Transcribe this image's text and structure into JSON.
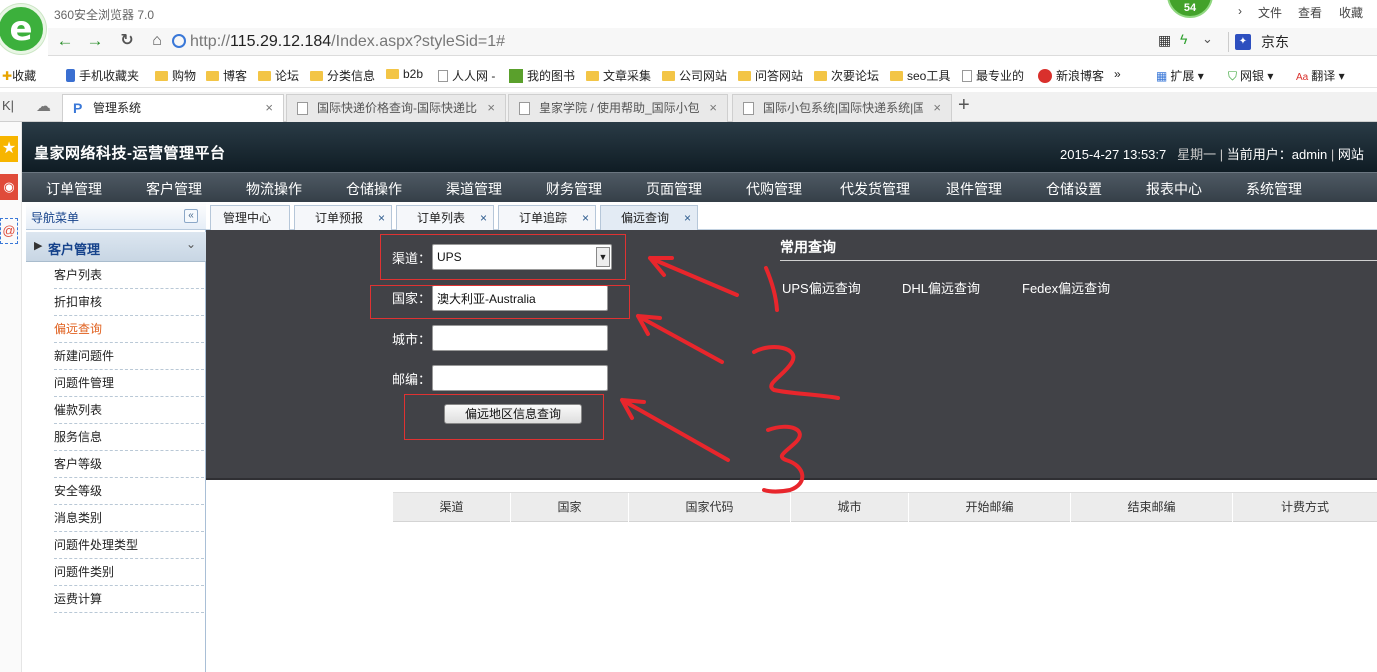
{
  "browser": {
    "title": "360安全浏览器 7.0",
    "badge": "54",
    "menu": [
      "文件",
      "查看",
      "收藏"
    ],
    "url_prefix": "http://",
    "url_host": "115.29.12.184",
    "url_path": "/Index.aspx?styleSid=1#",
    "search_engine": "京东",
    "bookmarks": [
      "收藏",
      "手机收藏夹",
      "购物",
      "博客",
      "论坛",
      "分类信息",
      "b2b",
      "人人网 -",
      "我的图书",
      "文章采集",
      "公司网站",
      "问答网站",
      "次要论坛",
      "seo工具",
      "最专业的",
      "新浪博客",
      "»",
      "扩展",
      "网银",
      "翻译"
    ],
    "tabs": [
      {
        "label": "管理系统"
      },
      {
        "label": "国际快递价格查询-国际快递比"
      },
      {
        "label": "皇家学院 / 使用帮助_国际小包"
      },
      {
        "label": "国际小包系统|国际快递系统|国"
      }
    ]
  },
  "app": {
    "title": "皇家网络科技-运营管理平台",
    "datetime": "2015-4-27 13:53:7",
    "weekday": "星期一",
    "current_user_label": "当前用户：",
    "user": "admin",
    "extra": "网站",
    "nav": [
      "订单管理",
      "客户管理",
      "物流操作",
      "仓储操作",
      "渠道管理",
      "财务管理",
      "页面管理",
      "代购管理",
      "代发货管理",
      "退件管理",
      "仓储设置",
      "报表中心",
      "系统管理"
    ]
  },
  "sidebar": {
    "title": "导航菜单",
    "group": "客户管理",
    "items": [
      "客户列表",
      "折扣审核",
      "偏远查询",
      "新建问题件",
      "问题件管理",
      "催款列表",
      "服务信息",
      "客户等级",
      "安全等级",
      "消息类别",
      "问题件处理类型",
      "问题件类别",
      "运费计算"
    ],
    "active": "偏远查询"
  },
  "page_tabs": [
    "管理中心",
    "订单预报",
    "订单列表",
    "订单追踪",
    "偏远查询"
  ],
  "form": {
    "channel_label": "渠道：",
    "channel_value": "UPS",
    "country_label": "国家：",
    "country_value": "澳大利亚-Australia",
    "city_label": "城市：",
    "city_value": "",
    "zip_label": "邮编：",
    "zip_value": "",
    "submit": "偏远地区信息查询"
  },
  "common_query": {
    "title": "常用查询",
    "links": [
      "UPS偏远查询",
      "DHL偏远查询",
      "Fedex偏远查询"
    ]
  },
  "result_table": {
    "columns": [
      "渠道",
      "国家",
      "国家代码",
      "城市",
      "开始邮编",
      "结束邮编",
      "计费方式"
    ]
  },
  "annotation_color": "#e8262c"
}
